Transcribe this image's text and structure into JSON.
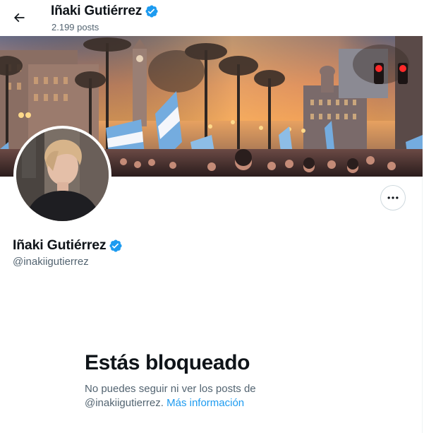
{
  "header": {
    "title": "Iñaki Gutiérrez",
    "posts_count": "2.199 posts"
  },
  "profile": {
    "name": "Iñaki Gutiérrez",
    "handle": "@inakiigutierrez"
  },
  "blocked": {
    "title": "Estás bloqueado",
    "message": "No puedes seguir ni ver los posts de",
    "handle": "@inakiigutierrez.",
    "link": "Más información"
  },
  "icons": {
    "back": "arrow-left-icon",
    "verified": "verified-badge-icon",
    "more": "more-horizontal-icon"
  },
  "colors": {
    "accent": "#1d9bf0",
    "text": "#0f1419",
    "secondary": "#536471"
  }
}
